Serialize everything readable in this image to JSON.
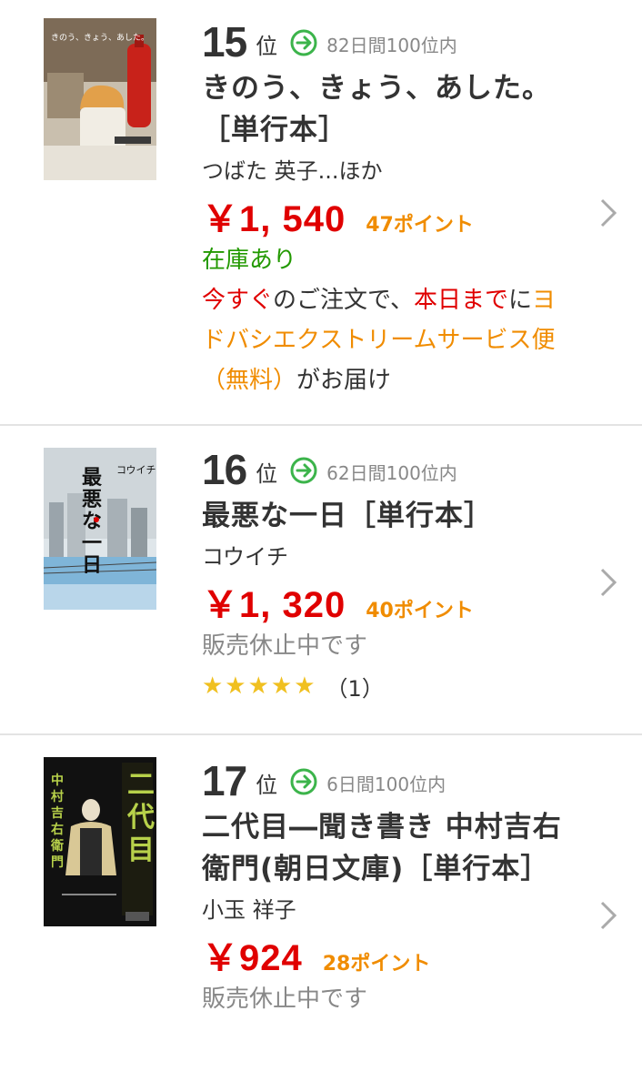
{
  "items": [
    {
      "rank": "15",
      "rank_unit": "位",
      "days_label": "82日間100位内",
      "title": "きのう、きょう、あした。［単行本］",
      "author": "つばた 英子...ほか",
      "price": "￥1, 540",
      "points": "47ポイント",
      "stock": "在庫あり",
      "delivery": {
        "part1": "今すぐ",
        "part2": "のご注文で、",
        "part3": "本日まで",
        "part4": "に",
        "part5": "ヨドバシエクストリームサービス便（無料）",
        "part6": "がお届け"
      }
    },
    {
      "rank": "16",
      "rank_unit": "位",
      "days_label": "62日間100位内",
      "title": "最悪な一日［単行本］",
      "author": "コウイチ",
      "price": "￥1, 320",
      "points": "40ポイント",
      "stock": "販売休止中です",
      "stars": "★★★★★",
      "review_count": "（1）"
    },
    {
      "rank": "17",
      "rank_unit": "位",
      "days_label": "6日間100位内",
      "title": "二代目―聞き書き 中村吉右衛門(朝日文庫)［単行本］",
      "author": "小玉 祥子",
      "price": "￥924",
      "points": "28ポイント",
      "stock": "販売休止中です"
    }
  ],
  "icons": {
    "trend": "arrow-right-circle-icon",
    "chevron": "chevron-right-icon"
  },
  "colors": {
    "price": "#e00000",
    "points": "#f08c00",
    "in_stock": "#229900",
    "trend": "#3cb44b"
  }
}
